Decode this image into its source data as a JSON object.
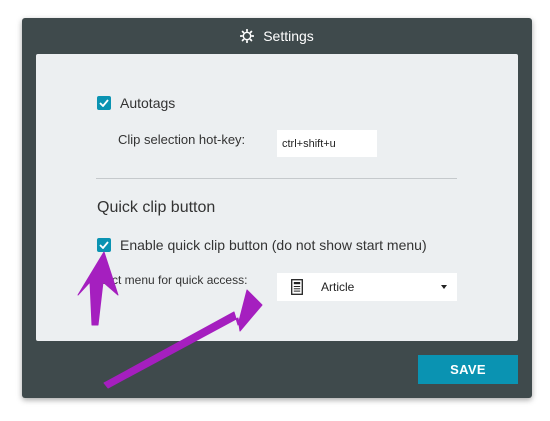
{
  "window": {
    "title": "Settings",
    "title_icon": "gear-icon"
  },
  "settings": {
    "autotags": {
      "label": "Autotags",
      "checked": true
    },
    "hotkey": {
      "label": "Clip selection hot-key:",
      "value": "ctrl+shift+u"
    },
    "quick_clip": {
      "section_title": "Quick clip button",
      "enable_label": "Enable quick clip button (do not show start menu)",
      "enable_checked": true,
      "menu_label": "Select menu for quick access:",
      "menu_selected": "Article",
      "menu_icon": "document-icon"
    }
  },
  "footer": {
    "save_label": "SAVE"
  },
  "colors": {
    "accent": "#0a93b2",
    "dialog_bg": "#3f4a4c",
    "panel_bg": "#eceff1",
    "annotation_arrow": "#a51fbf"
  }
}
